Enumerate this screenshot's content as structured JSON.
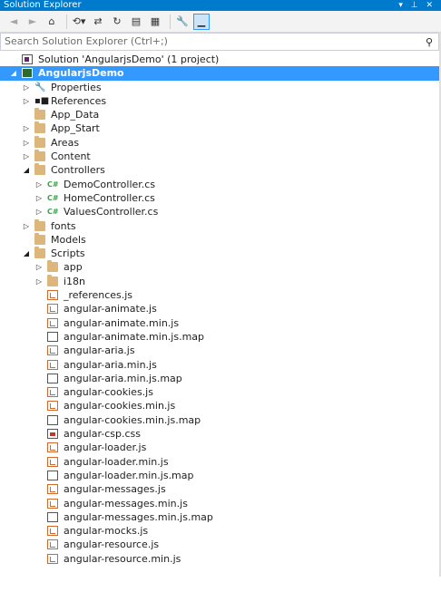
{
  "panel": {
    "title": "Solution Explorer",
    "title_glyphs": "▾ ⊥ ✕"
  },
  "toolbar": {
    "buttons": [
      {
        "name": "back-button",
        "icon": "◄",
        "dim": true
      },
      {
        "name": "forward-button",
        "icon": "►",
        "dim": true
      },
      {
        "name": "home-button",
        "icon": "⌂",
        "dim": false
      },
      {
        "name": "sep"
      },
      {
        "name": "history-button",
        "icon": "⟲▾",
        "dim": false
      },
      {
        "name": "sync-button",
        "icon": "⇄",
        "dim": false
      },
      {
        "name": "refresh-button",
        "icon": "↻",
        "dim": false
      },
      {
        "name": "collapse-all-button",
        "icon": "▤",
        "dim": false
      },
      {
        "name": "show-all-files-button",
        "icon": "▦",
        "dim": false
      },
      {
        "name": "sep"
      },
      {
        "name": "properties-button",
        "icon": "🔧",
        "dim": false
      },
      {
        "name": "pin-preview-button",
        "icon": "▁",
        "dim": false,
        "selected": true
      }
    ]
  },
  "search": {
    "placeholder": "Search Solution Explorer (Ctrl+;)",
    "icon": "search-icon"
  },
  "tree": [
    {
      "label": "Solution 'AngularjsDemo' (1 project)",
      "level": 0,
      "arrow": "",
      "icon": "solution-icon"
    },
    {
      "label": "AngularjsDemo",
      "level": 0,
      "arrow": "◢",
      "icon": "project-icon",
      "selected": true
    },
    {
      "label": "Properties",
      "level": 1,
      "arrow": "▷",
      "icon": "wrench-icon"
    },
    {
      "label": "References",
      "level": 1,
      "arrow": "▷",
      "icon": "references-icon"
    },
    {
      "label": "App_Data",
      "level": 1,
      "arrow": "",
      "icon": "folder-icon"
    },
    {
      "label": "App_Start",
      "level": 1,
      "arrow": "▷",
      "icon": "folder-icon"
    },
    {
      "label": "Areas",
      "level": 1,
      "arrow": "▷",
      "icon": "folder-icon"
    },
    {
      "label": "Content",
      "level": 1,
      "arrow": "▷",
      "icon": "folder-icon"
    },
    {
      "label": "Controllers",
      "level": 1,
      "arrow": "◢",
      "icon": "folder-open-icon"
    },
    {
      "label": "DemoController.cs",
      "level": 2,
      "arrow": "▷",
      "icon": "csharp-icon"
    },
    {
      "label": "HomeController.cs",
      "level": 2,
      "arrow": "▷",
      "icon": "csharp-icon"
    },
    {
      "label": "ValuesController.cs",
      "level": 2,
      "arrow": "▷",
      "icon": "csharp-icon"
    },
    {
      "label": "fonts",
      "level": 1,
      "arrow": "▷",
      "icon": "folder-icon"
    },
    {
      "label": "Models",
      "level": 1,
      "arrow": "",
      "icon": "folder-icon"
    },
    {
      "label": "Scripts",
      "level": 1,
      "arrow": "◢",
      "icon": "folder-open-icon"
    },
    {
      "label": "app",
      "level": 2,
      "arrow": "▷",
      "icon": "folder-icon"
    },
    {
      "label": "i18n",
      "level": 2,
      "arrow": "▷",
      "icon": "folder-icon"
    },
    {
      "label": "_references.js",
      "level": 2,
      "arrow": "",
      "icon": "js-file-icon"
    },
    {
      "label": "angular-animate.js",
      "level": 2,
      "arrow": "",
      "icon": "js-file-icon"
    },
    {
      "label": "angular-animate.min.js",
      "level": 2,
      "arrow": "",
      "icon": "js-file-icon"
    },
    {
      "label": "angular-animate.min.js.map",
      "level": 2,
      "arrow": "",
      "icon": "map-file-icon"
    },
    {
      "label": "angular-aria.js",
      "level": 2,
      "arrow": "",
      "icon": "js-file-icon"
    },
    {
      "label": "angular-aria.min.js",
      "level": 2,
      "arrow": "",
      "icon": "js-file-icon"
    },
    {
      "label": "angular-aria.min.js.map",
      "level": 2,
      "arrow": "",
      "icon": "map-file-icon"
    },
    {
      "label": "angular-cookies.js",
      "level": 2,
      "arrow": "",
      "icon": "js-file-icon"
    },
    {
      "label": "angular-cookies.min.js",
      "level": 2,
      "arrow": "",
      "icon": "js-file-icon"
    },
    {
      "label": "angular-cookies.min.js.map",
      "level": 2,
      "arrow": "",
      "icon": "map-file-icon"
    },
    {
      "label": "angular-csp.css",
      "level": 2,
      "arrow": "",
      "icon": "css-file-icon"
    },
    {
      "label": "angular-loader.js",
      "level": 2,
      "arrow": "",
      "icon": "js-file-icon"
    },
    {
      "label": "angular-loader.min.js",
      "level": 2,
      "arrow": "",
      "icon": "js-file-icon"
    },
    {
      "label": "angular-loader.min.js.map",
      "level": 2,
      "arrow": "",
      "icon": "map-file-icon"
    },
    {
      "label": "angular-messages.js",
      "level": 2,
      "arrow": "",
      "icon": "js-file-icon"
    },
    {
      "label": "angular-messages.min.js",
      "level": 2,
      "arrow": "",
      "icon": "js-file-icon"
    },
    {
      "label": "angular-messages.min.js.map",
      "level": 2,
      "arrow": "",
      "icon": "map-file-icon"
    },
    {
      "label": "angular-mocks.js",
      "level": 2,
      "arrow": "",
      "icon": "js-file-icon"
    },
    {
      "label": "angular-resource.js",
      "level": 2,
      "arrow": "",
      "icon": "js-file-icon"
    },
    {
      "label": "angular-resource.min.js",
      "level": 2,
      "arrow": "",
      "icon": "js-file-icon"
    }
  ],
  "colors": {
    "accent": "#007acc",
    "selection": "#3399ff",
    "folder": "#dcb67a",
    "js": "#d0692b",
    "csharp": "#39a14c"
  }
}
